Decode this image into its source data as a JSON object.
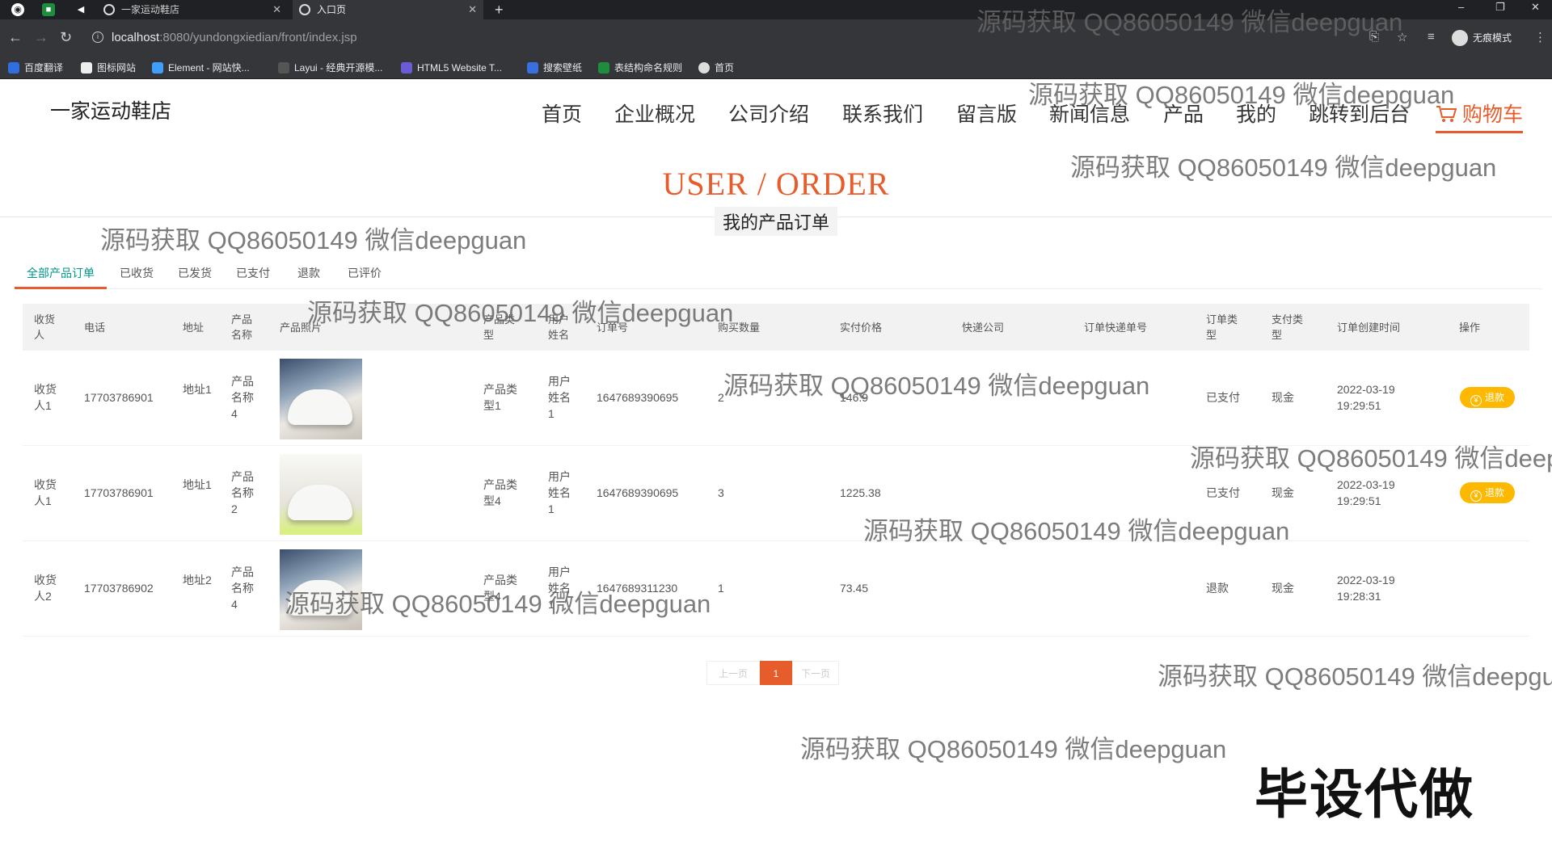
{
  "browser": {
    "tabs": [
      {
        "label": "一家运动鞋店",
        "active": false
      },
      {
        "label": "入口页",
        "active": true
      }
    ],
    "url_host": "localhost",
    "url_path": ":8080/yundongxiedian/front/index.jsp",
    "incognito_label": "无痕模式",
    "bookmarks": [
      "百度翻译",
      "图标网站",
      "Element - 网站快...",
      "Layui - 经典开源模...",
      "HTML5 Website T...",
      "搜索壁纸",
      "表结构命名规则",
      "首页"
    ]
  },
  "site": {
    "logo": "一家运动鞋店",
    "nav": [
      "首页",
      "企业概况",
      "公司介绍",
      "联系我们",
      "留言版",
      "新闻信息",
      "产品",
      "我的",
      "跳转到后台"
    ],
    "cart_label": "购物车"
  },
  "section": {
    "title": "USER / ORDER",
    "subtitle": "我的产品订单"
  },
  "subtabs": [
    "全部产品订单",
    "已收货",
    "已发货",
    "已支付",
    "退款",
    "已评价"
  ],
  "table": {
    "headers": [
      "收货人",
      "电话",
      "地址",
      "产品名称",
      "产品照片",
      "产品类型",
      "用户姓名",
      "订单号",
      "购买数量",
      "实付价格",
      "快递公司",
      "订单快递单号",
      "订单类型",
      "支付类型",
      "订单创建时间",
      "操作"
    ],
    "rows": [
      {
        "receiver": "收货人1",
        "phone": "17703786901",
        "address": "地址1",
        "product": "产品名称4",
        "type": "产品类型1",
        "user": "用户姓名1",
        "order_no": "1647689390695",
        "qty": "2",
        "price": "146.9",
        "express": "",
        "express_no": "",
        "order_type": "已支付",
        "pay_type": "现金",
        "date": "2022-03-19",
        "time": "19:29:51",
        "action": "退款"
      },
      {
        "receiver": "收货人1",
        "phone": "17703786901",
        "address": "地址1",
        "product": "产品名称2",
        "type": "产品类型4",
        "user": "用户姓名1",
        "order_no": "1647689390695",
        "qty": "3",
        "price": "1225.38",
        "express": "",
        "express_no": "",
        "order_type": "已支付",
        "pay_type": "现金",
        "date": "2022-03-19",
        "time": "19:29:51",
        "action": "退款"
      },
      {
        "receiver": "收货人2",
        "phone": "17703786902",
        "address": "地址2",
        "product": "产品名称4",
        "type": "产品类型4",
        "user": "用户姓名1",
        "order_no": "1647689311230",
        "qty": "1",
        "price": "73.45",
        "express": "",
        "express_no": "",
        "order_type": "退款",
        "pay_type": "现金",
        "date": "2022-03-19",
        "time": "19:28:31",
        "action": ""
      }
    ]
  },
  "pagination": {
    "prev": "上一页",
    "current": "1",
    "next": "下一页"
  },
  "watermark": "源码获取 QQ86050149 微信deepguan",
  "corner_mark": "毕设代做",
  "colors": {
    "accent": "#e65c2a",
    "active_tab": "#009688",
    "refund_button": "#ffb800"
  }
}
